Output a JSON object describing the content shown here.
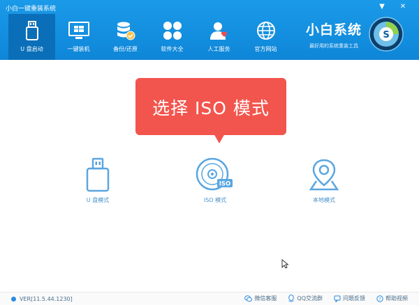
{
  "window": {
    "title": "小白一键重装系统",
    "minimize_label": "▼",
    "close_label": "✕"
  },
  "nav": {
    "items": [
      {
        "label": "U 盘启动",
        "icon": "usb-drive-icon",
        "active": true
      },
      {
        "label": "一键装机",
        "icon": "monitor-windows-icon",
        "active": false
      },
      {
        "label": "备份/还原",
        "icon": "database-backup-icon",
        "active": false
      },
      {
        "label": "软件大全",
        "icon": "apps-grid-icon",
        "active": false
      },
      {
        "label": "人工服务",
        "icon": "person-heart-icon",
        "active": false
      },
      {
        "label": "官方网站",
        "icon": "globe-icon",
        "active": false
      }
    ]
  },
  "brand": {
    "name": "小白系统",
    "slogan": "最好用的系统重装工具"
  },
  "banner": {
    "text": "选择 ISO 模式"
  },
  "modes": [
    {
      "label": "U 盘模式",
      "icon": "usb-stick-icon"
    },
    {
      "label": "ISO 模式",
      "icon": "iso-disc-icon",
      "badge": "ISO"
    },
    {
      "label": "本地模式",
      "icon": "map-pin-icon"
    }
  ],
  "footer": {
    "version": "VER[11.5.44.1230]",
    "links": [
      {
        "label": "微信客服",
        "icon": "wechat-icon"
      },
      {
        "label": "QQ交流群",
        "icon": "qq-icon"
      },
      {
        "label": "问题反馈",
        "icon": "feedback-icon"
      },
      {
        "label": "帮助视频",
        "icon": "help-icon"
      }
    ]
  },
  "colors": {
    "header": "#1a9ae8",
    "nav_active": "#0a6fb8",
    "banner": "#f2554d",
    "icon_accent": "#5aa6e0"
  }
}
